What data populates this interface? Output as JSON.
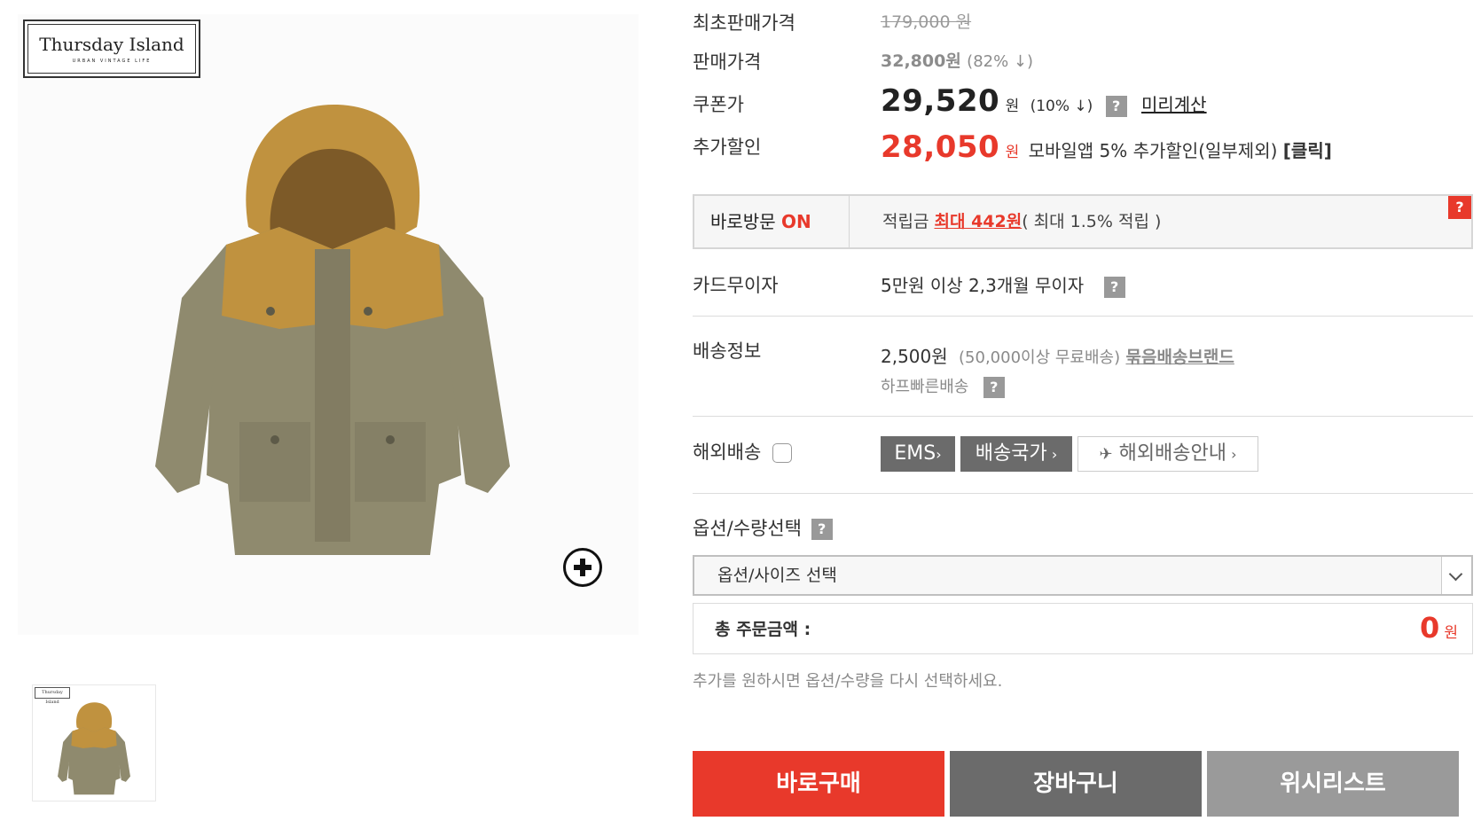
{
  "brand": {
    "name": "Thursday Island",
    "tagline": "URBAN VINTAGE LIFE"
  },
  "product": {
    "original_price_label": "최초판매가격",
    "original_price": "179,000 원",
    "sale_price_label": "판매가격",
    "sale_price": "32,800원",
    "sale_discount": "(82% ↓)",
    "coupon_label": "쿠폰가",
    "coupon_price": "29,520",
    "coupon_won": "원",
    "coupon_discount": "(10% ↓)",
    "coupon_help": "?",
    "precalc_link": "미리계산",
    "extra_label": "추가할인",
    "extra_price": "28,050",
    "extra_won": "원",
    "extra_desc": "모바일앱 5% 추가할인(일부제외)",
    "extra_click": "[클릭]"
  },
  "visit": {
    "label": "바로방문",
    "status": "ON",
    "points_label": "적립금",
    "points_max": "최대 442원",
    "points_rate": "( 최대 1.5% 적립 )",
    "help": "?"
  },
  "card": {
    "label": "카드무이자",
    "value": "5만원 이상 2,3개월 무이자",
    "help": "?"
  },
  "shipping": {
    "label": "배송정보",
    "fee": "2,500원",
    "free_cond": "(50,000이상 무료배송)",
    "bundle_link": "묶음배송브랜드",
    "fast": "하프빠른배송",
    "help": "?"
  },
  "overseas": {
    "label": "해외배송",
    "ems_button": "EMS",
    "country_button": "배송국가",
    "guide_button": "해외배송안내"
  },
  "options": {
    "label": "옵션/수량선택",
    "help": "?",
    "select_placeholder": "옵션/사이즈 선택",
    "total_label": "총 주문금액 :",
    "total_value": "0",
    "total_won": "원",
    "note": "추가를 원하시면 옵션/수량을 다시 선택하세요."
  },
  "actions": {
    "buy_now": "바로구매",
    "cart": "장바구니",
    "wishlist": "위시리스트"
  },
  "colors": {
    "accent_red": "#e8392b",
    "cart_gray": "#6b6b6b",
    "wish_gray": "#9a9a9a"
  }
}
